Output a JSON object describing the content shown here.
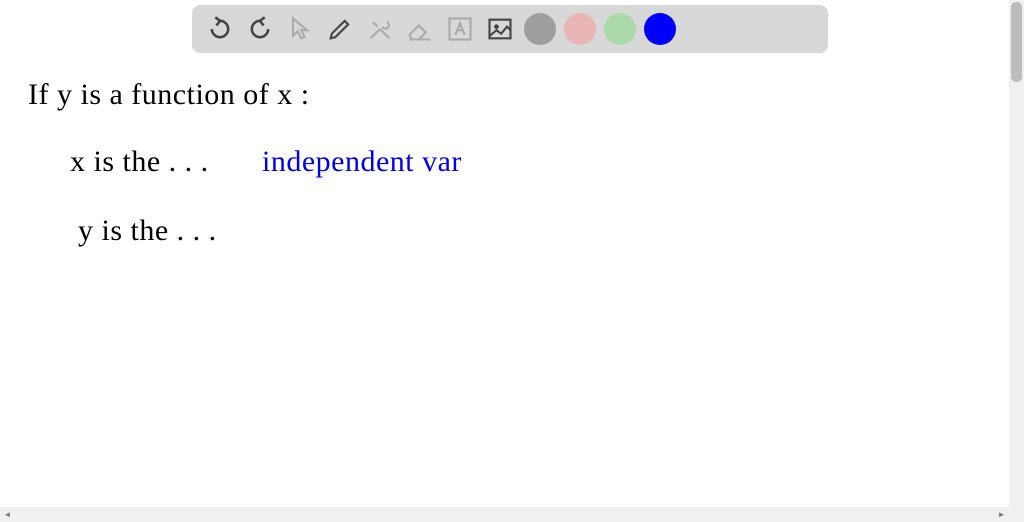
{
  "toolbar": {
    "undo_icon": "undo",
    "redo_icon": "redo",
    "pointer_icon": "pointer",
    "pen_icon": "pen",
    "tools_icon": "tools",
    "eraser_icon": "eraser",
    "text_icon": "text",
    "image_icon": "image",
    "colors": {
      "gray": "#9e9e9e",
      "pink": "#e9b6b6",
      "green": "#aadaaa",
      "blue": "#0000ff"
    }
  },
  "handwriting": {
    "line1": "If y is a function of x :",
    "line2_black": "x is the . . .",
    "line2_blue": "independent var",
    "line3": "y is the . . ."
  }
}
